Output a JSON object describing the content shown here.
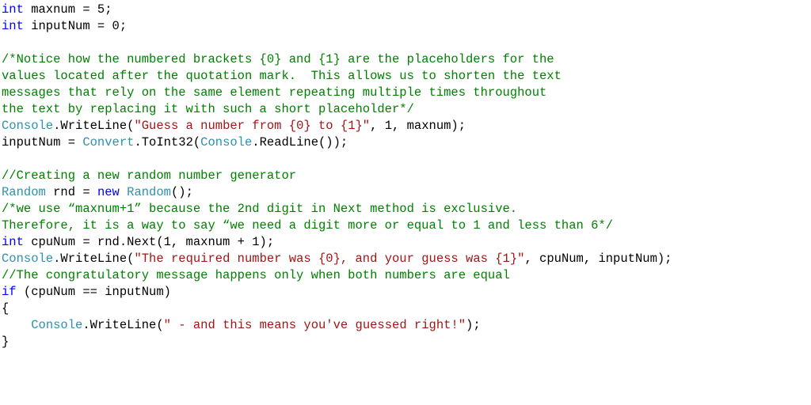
{
  "lines": [
    [
      {
        "cls": "kw",
        "t": "int"
      },
      {
        "cls": "pln",
        "t": " maxnum = 5;"
      }
    ],
    [
      {
        "cls": "kw",
        "t": "int"
      },
      {
        "cls": "pln",
        "t": " inputNum = 0;"
      }
    ],
    [],
    [
      {
        "cls": "cmt",
        "t": "/*Notice how the numbered brackets {0} and {1} are the placeholders for the"
      }
    ],
    [
      {
        "cls": "cmt",
        "t": "values located after the quotation mark.  This allows us to shorten the text"
      }
    ],
    [
      {
        "cls": "cmt",
        "t": "messages that rely on the same element repeating multiple times throughout"
      }
    ],
    [
      {
        "cls": "cmt",
        "t": "the text by replacing it with such a short placeholder*/"
      }
    ],
    [
      {
        "cls": "typ",
        "t": "Console"
      },
      {
        "cls": "pln",
        "t": ".WriteLine("
      },
      {
        "cls": "str",
        "t": "\"Guess a number from {0} to {1}\""
      },
      {
        "cls": "pln",
        "t": ", 1, maxnum);"
      }
    ],
    [
      {
        "cls": "pln",
        "t": "inputNum = "
      },
      {
        "cls": "typ",
        "t": "Convert"
      },
      {
        "cls": "pln",
        "t": ".ToInt32("
      },
      {
        "cls": "typ",
        "t": "Console"
      },
      {
        "cls": "pln",
        "t": ".ReadLine());"
      }
    ],
    [],
    [
      {
        "cls": "cmt",
        "t": "//Creating a new random number generator"
      }
    ],
    [
      {
        "cls": "typ",
        "t": "Random"
      },
      {
        "cls": "pln",
        "t": " rnd = "
      },
      {
        "cls": "kw",
        "t": "new"
      },
      {
        "cls": "pln",
        "t": " "
      },
      {
        "cls": "typ",
        "t": "Random"
      },
      {
        "cls": "pln",
        "t": "();"
      }
    ],
    [
      {
        "cls": "cmt",
        "t": "/*we use “maxnum+1” because the 2nd digit in Next method is exclusive."
      }
    ],
    [
      {
        "cls": "cmt",
        "t": "Therefore, it is a way to say “we need a digit more or equal to 1 and less than 6*/"
      }
    ],
    [
      {
        "cls": "kw",
        "t": "int"
      },
      {
        "cls": "pln",
        "t": " cpuNum = rnd.Next(1, maxnum + 1);"
      }
    ],
    [
      {
        "cls": "typ",
        "t": "Console"
      },
      {
        "cls": "pln",
        "t": ".WriteLine("
      },
      {
        "cls": "str",
        "t": "\"The required number was {0}, and your guess was {1}\""
      },
      {
        "cls": "pln",
        "t": ", cpuNum, inputNum);"
      }
    ],
    [
      {
        "cls": "cmt",
        "t": "//The congratulatory message happens only when both numbers are equal"
      }
    ],
    [
      {
        "cls": "kw",
        "t": "if"
      },
      {
        "cls": "pln",
        "t": " (cpuNum == inputNum)"
      }
    ],
    [
      {
        "cls": "pln",
        "t": "{"
      }
    ],
    [
      {
        "cls": "pln",
        "t": "    "
      },
      {
        "cls": "typ",
        "t": "Console"
      },
      {
        "cls": "pln",
        "t": ".WriteLine("
      },
      {
        "cls": "str",
        "t": "\" - and this means you've guessed right!\""
      },
      {
        "cls": "pln",
        "t": ");"
      }
    ],
    [
      {
        "cls": "pln",
        "t": "}"
      }
    ]
  ]
}
